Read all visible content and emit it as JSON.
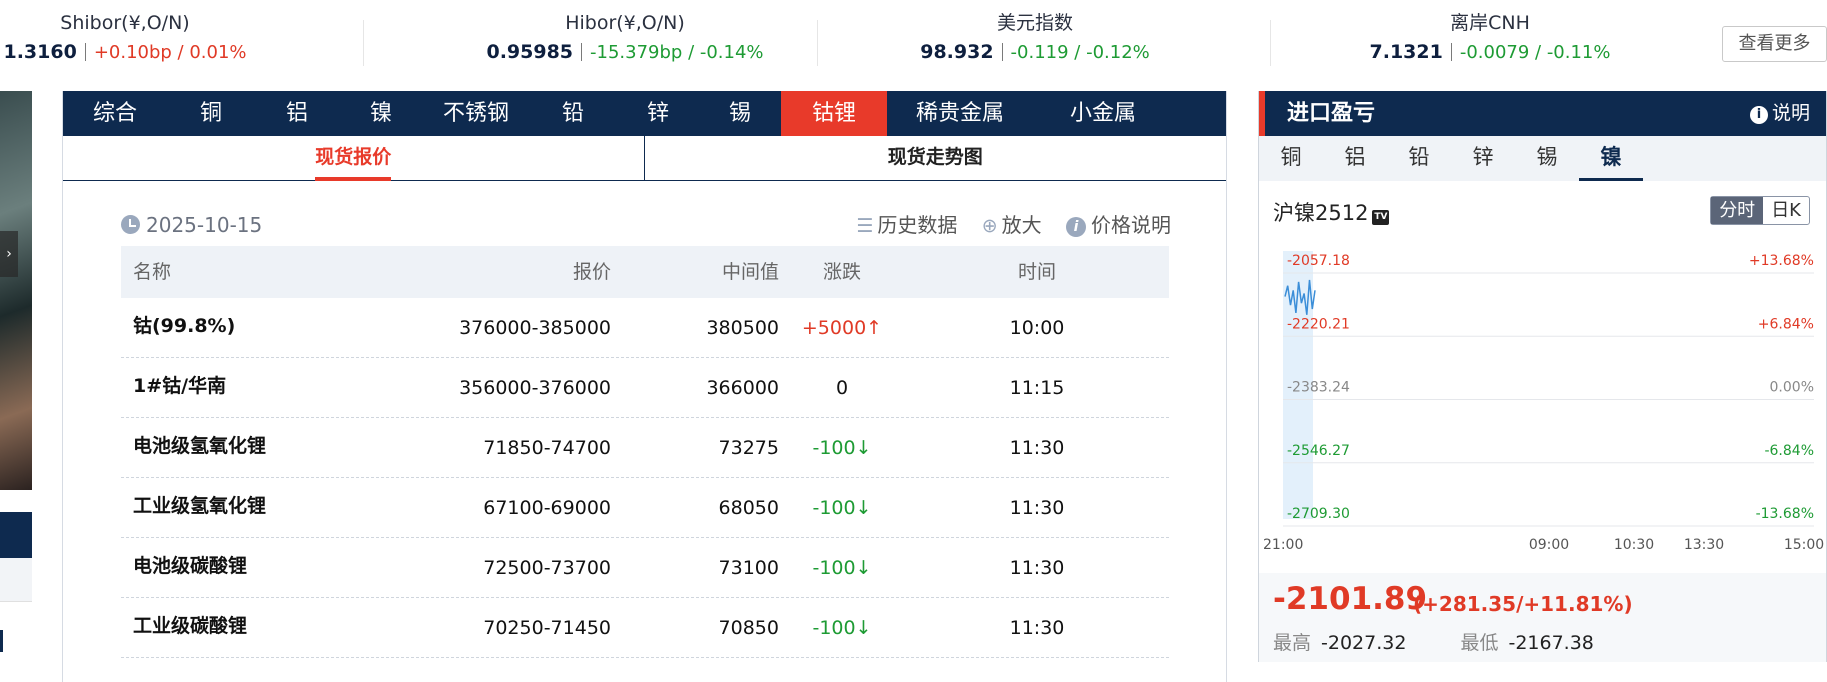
{
  "ticker": [
    {
      "name": "Shibor(¥,O/N)",
      "value": "1.3160",
      "change": "+0.10bp / 0.01%",
      "direction": "up"
    },
    {
      "name": "Hibor(¥,O/N)",
      "value": "0.95985",
      "change": "-15.379bp / -0.14%",
      "direction": "down"
    },
    {
      "name": "美元指数",
      "value": "98.932",
      "change": "-0.119 / -0.12%",
      "direction": "down"
    },
    {
      "name": "离岸CNH",
      "value": "7.1321",
      "change": "-0.0079 / -0.11%",
      "direction": "down"
    }
  ],
  "more_label": "查看更多",
  "metal_tabs": [
    "综合",
    "铜",
    "铝",
    "镍",
    "不锈钢",
    "铅",
    "锌",
    "锡",
    "钴锂",
    "稀贵金属",
    "小金属"
  ],
  "active_metal_tab": "钴锂",
  "sub_tabs": {
    "spot_price": "现货报价",
    "spot_trend": "现货走势图"
  },
  "date": "2025-10-15",
  "actions": {
    "history": "历史数据",
    "zoom": "放大",
    "price_note": "价格说明"
  },
  "table": {
    "headers": {
      "name": "名称",
      "price": "报价",
      "mid": "中间值",
      "change": "涨跌",
      "time": "时间"
    },
    "rows": [
      {
        "name": "钴(99.8%)",
        "price": "376000-385000",
        "mid": "380500",
        "change": "+5000↑",
        "dir": "up",
        "time": "10:00"
      },
      {
        "name": "1#钴/华南",
        "price": "356000-376000",
        "mid": "366000",
        "change": "0",
        "dir": "flat",
        "time": "11:15"
      },
      {
        "name": "电池级氢氧化锂",
        "price": "71850-74700",
        "mid": "73275",
        "change": "-100↓",
        "dir": "down",
        "time": "11:30"
      },
      {
        "name": "工业级氢氧化锂",
        "price": "67100-69000",
        "mid": "68050",
        "change": "-100↓",
        "dir": "down",
        "time": "11:30"
      },
      {
        "name": "电池级碳酸锂",
        "price": "72500-73700",
        "mid": "73100",
        "change": "-100↓",
        "dir": "down",
        "time": "11:30"
      },
      {
        "name": "工业级碳酸锂",
        "price": "70250-71450",
        "mid": "70850",
        "change": "-100↓",
        "dir": "down",
        "time": "11:30"
      }
    ]
  },
  "import_panel": {
    "title": "进口盈亏",
    "help": "说明",
    "tabs": [
      "铜",
      "铝",
      "铅",
      "锌",
      "锡",
      "镍"
    ],
    "active_tab": "镍",
    "contract": "沪镍2512",
    "tv_badge": "TV",
    "periods": [
      "分时",
      "日K"
    ],
    "active_period": "分时",
    "last": "-2101.89",
    "change": "(+281.35/+11.81%)",
    "high_label": "最高",
    "high": "-2027.32",
    "low_label": "最低",
    "low": "-2167.38"
  },
  "chart_data": {
    "type": "line",
    "y_ticks_left": [
      "-2057.18",
      "-2220.21",
      "-2383.24",
      "-2546.27",
      "-2709.30"
    ],
    "y_ticks_right": [
      "+13.68%",
      "+6.84%",
      "0.00%",
      "-6.84%",
      "-13.68%"
    ],
    "x_ticks": [
      "21:00",
      "09:00",
      "10:30",
      "13:30",
      "15:00"
    ],
    "ylim": [
      -2709.3,
      -2057.18
    ],
    "series": [
      {
        "values": [
          -2118,
          -2090,
          -2140,
          -2102,
          -2160,
          -2080,
          -2135,
          -2110,
          -2165,
          -2075,
          -2150,
          -2101.89
        ]
      }
    ],
    "colors": {
      "line": "#3b8ed8",
      "fill": "#e3f0fb",
      "grid": "#e5e7eb",
      "up": "#e03a26",
      "down": "#1e9b34",
      "mid": "#888888"
    }
  }
}
